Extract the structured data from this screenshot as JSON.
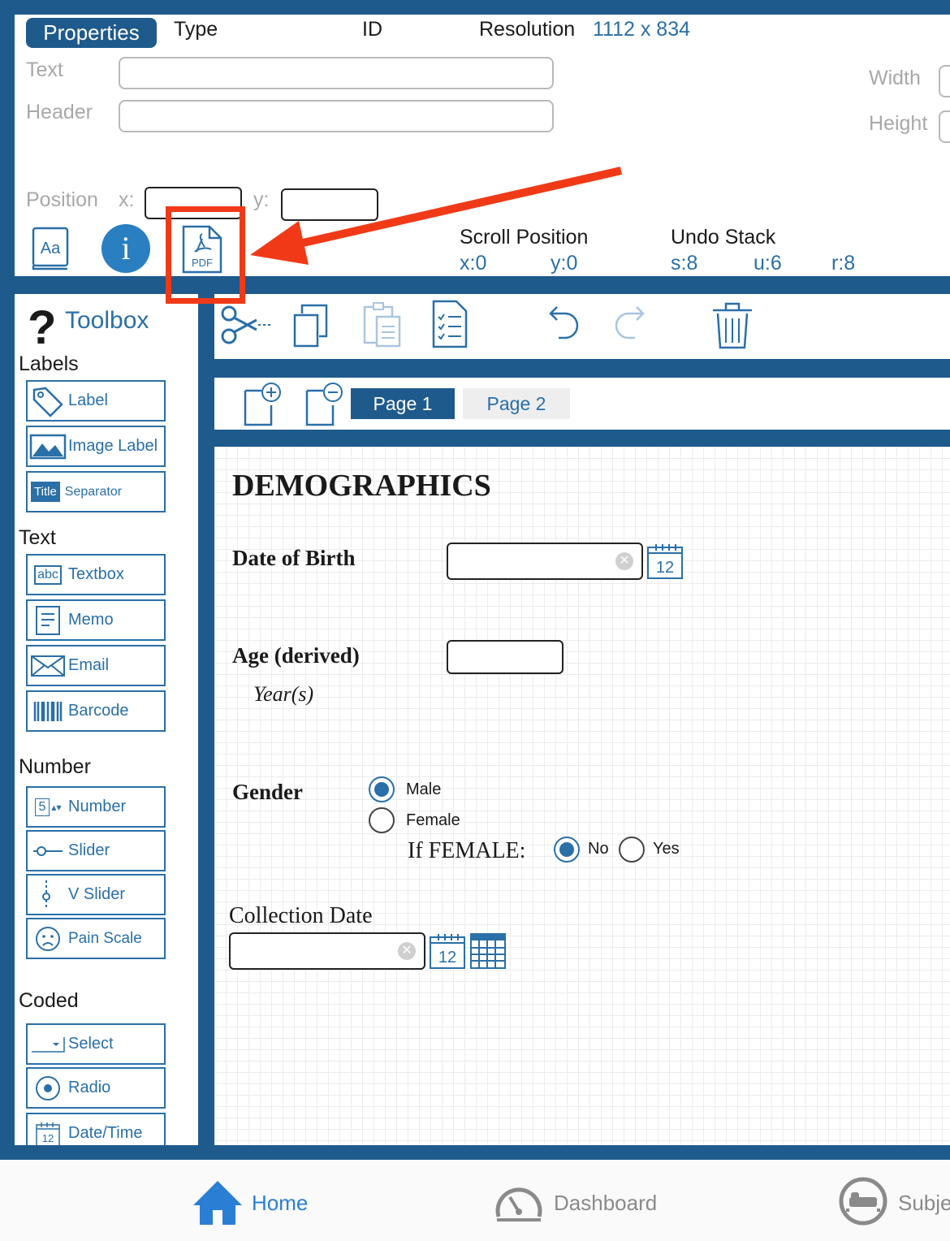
{
  "properties": {
    "tab_label": "Properties",
    "type_label": "Type",
    "id_label": "ID",
    "resolution_label": "Resolution",
    "resolution_value": "1112 x 834",
    "text_label": "Text",
    "header_label": "Header",
    "width_label": "Width",
    "height_label": "Height",
    "position_label": "Position",
    "x_label": "x:",
    "y_label": "y:",
    "pdf_icon_text": "PDF",
    "font_icon_text": "Aa",
    "info_icon_text": "i",
    "scroll_position_label": "Scroll Position",
    "scroll_x": "x:0",
    "scroll_y": "y:0",
    "undo_stack_label": "Undo Stack",
    "undo_s": "s:8",
    "undo_u": "u:6",
    "undo_r": "r:8"
  },
  "annotation": {
    "highlight_color": "#f03a17"
  },
  "toolbox": {
    "title": "Toolbox",
    "sections": {
      "labels": "Labels",
      "text": "Text",
      "number": "Number",
      "coded": "Coded"
    },
    "items": {
      "label": "Label",
      "image_label": "Image Label",
      "separator_tag": "Title",
      "separator": "Separator",
      "textbox_tag": "abc",
      "textbox": "Textbox",
      "memo": "Memo",
      "email": "Email",
      "barcode": "Barcode",
      "number_tag": "5",
      "number": "Number",
      "slider": "Slider",
      "v_slider": "V Slider",
      "pain_scale": "Pain Scale",
      "select": "Select",
      "radio": "Radio",
      "datetime_tag": "12",
      "datetime": "Date/Time"
    }
  },
  "pages": {
    "tabs": [
      "Page 1",
      "Page 2"
    ],
    "active_index": 0
  },
  "form": {
    "title": "DEMOGRAPHICS",
    "dob_label": "Date of Birth",
    "calendar_day": "12",
    "age_label": "Age (derived)",
    "age_unit": "Year(s)",
    "gender_label": "Gender",
    "gender_options": [
      "Male",
      "Female"
    ],
    "gender_selected": "Male",
    "if_female_label": "If FEMALE:",
    "if_female_options": [
      "No",
      "Yes"
    ],
    "if_female_selected": "No",
    "collection_date_label": "Collection Date"
  },
  "tabbar": {
    "home": "Home",
    "dashboard": "Dashboard",
    "subjects": "Subje"
  },
  "colors": {
    "brand_blue": "#1f5a8c",
    "accent_blue": "#2a6fa8",
    "annotation_red": "#f03a17"
  }
}
